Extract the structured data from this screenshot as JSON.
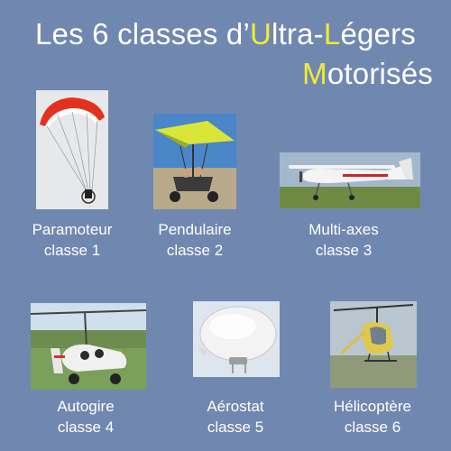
{
  "title": {
    "line1_pre": "Les 6 classes d’",
    "u_accent": "U",
    "u_rest": "ltra-",
    "l_accent": "L",
    "l_rest": "égers",
    "m_accent": "M",
    "m_rest": "otorisés"
  },
  "classes": [
    {
      "name": "Paramoteur",
      "label": "classe 1",
      "icon": "paramotor-photo"
    },
    {
      "name": "Pendulaire",
      "label": "classe 2",
      "icon": "weight-shift-trike-photo"
    },
    {
      "name": "Multi-axes",
      "label": "classe 3",
      "icon": "three-axis-aircraft-photo"
    },
    {
      "name": "Autogire",
      "label": "classe 4",
      "icon": "gyrocopter-photo"
    },
    {
      "name": "Aérostat",
      "label": "classe 5",
      "icon": "airship-photo"
    },
    {
      "name": "Hélicoptère",
      "label": "classe 6",
      "icon": "helicopter-photo"
    }
  ],
  "colors": {
    "background": "#7088b0",
    "text": "#ffffff",
    "accent": "#f2ec2e"
  }
}
